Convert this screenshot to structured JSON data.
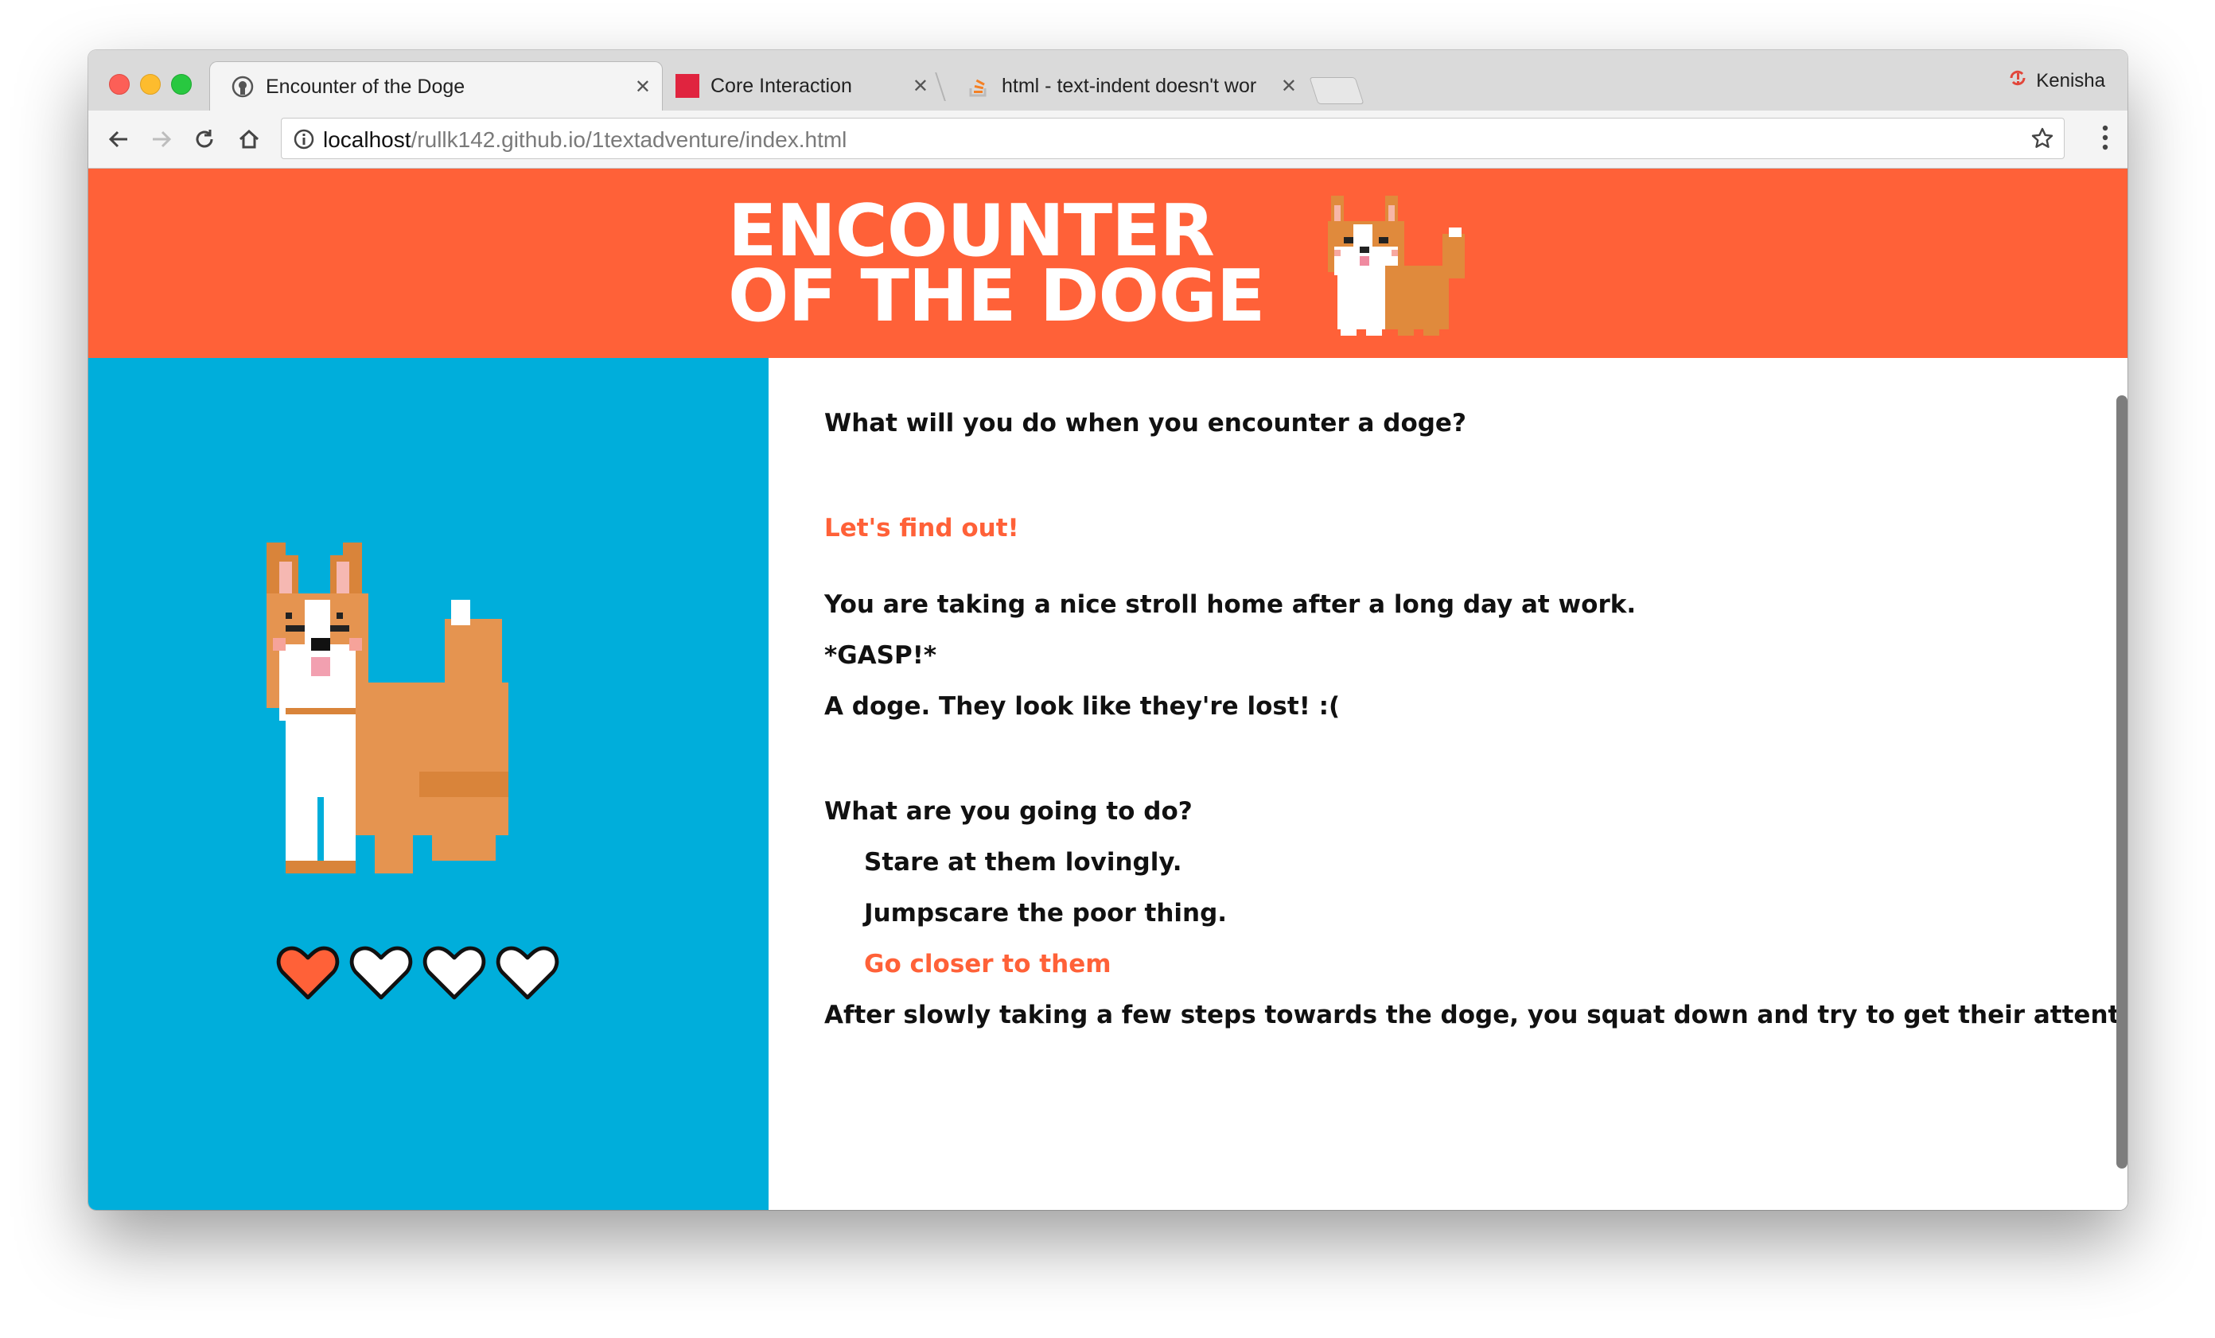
{
  "browser": {
    "tabs": [
      {
        "title": "Encounter of the Doge",
        "active": true,
        "favicon": "github-icon"
      },
      {
        "title": "Core Interaction",
        "active": false,
        "favicon": "red-square-icon"
      },
      {
        "title": "html - text-indent doesn't wor",
        "active": false,
        "favicon": "stackoverflow-icon"
      }
    ],
    "profile_name": "Kenisha",
    "url_host": "localhost",
    "url_path": "/rullk142.github.io/1textadventure/index.html"
  },
  "page": {
    "title_line1": "ENCOUNTER",
    "title_line2": "OF THE DOGE",
    "colors": {
      "accent": "#ff6138",
      "panel": "#00aedb"
    },
    "hearts": {
      "filled": 1,
      "total": 4
    },
    "story": {
      "question": "What will you do when you encounter a doge?",
      "cta": "Let's find out!",
      "line1": "You are taking a nice stroll home after a long day at work.",
      "line2": "*GASP!*",
      "line3": "A doge. They look like they're lost! :(",
      "prompt": "What are you going to do?",
      "choices": [
        "Stare at them lovingly.",
        "Jumpscare the poor thing.",
        "Go closer to them"
      ],
      "result": "After slowly taking a few steps towards the doge, you squat down and try to get their attention."
    }
  }
}
